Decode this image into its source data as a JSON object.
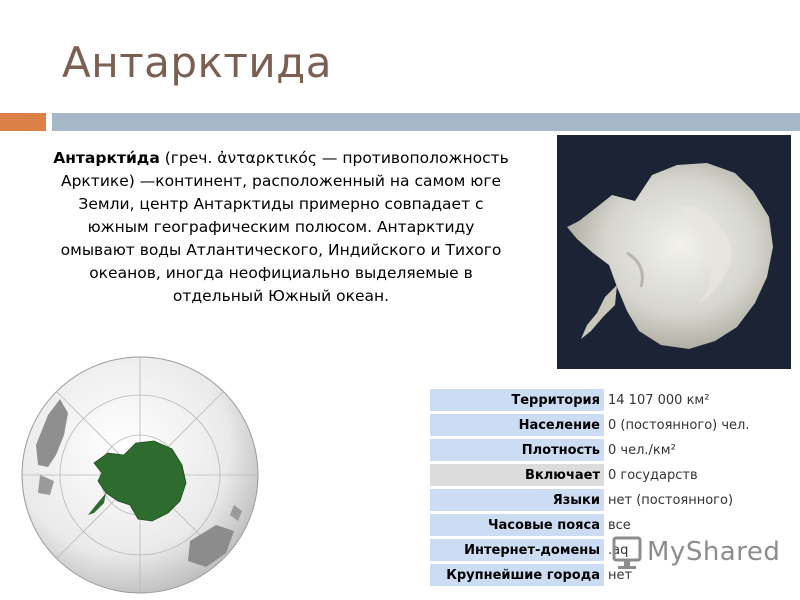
{
  "slide": {
    "title": "Антарктида",
    "paragraph": {
      "term": "Антаркти́да",
      "body": " (греч. ἀνταρκτικός — противоположность Арктике) —континент, расположенный на самом юге Земли, центр Антарктиды примерно совпадает с южным географическим полюсом. Антарктиду омывают воды Атлантического, Индийского и Тихого океанов, иногда неофициально выделяемые в отдельный Южный океан."
    },
    "colors": {
      "title": "#7a5f52",
      "accent_orange": "#dd8047",
      "accent_blue": "#a6b7c7",
      "continent_green": "#2e6b2e"
    }
  },
  "infobox": {
    "rows": [
      {
        "label": "Территория",
        "value": "14 107 000 км²"
      },
      {
        "label": "Население",
        "value": "0 (постоянного) чел."
      },
      {
        "label": "Плотность",
        "value": "0 чел./км²"
      },
      {
        "label": "Включает",
        "value": "0 государств"
      },
      {
        "label": "Языки",
        "value": "нет (постоянного)"
      },
      {
        "label": "Часовые пояса",
        "value": "все"
      },
      {
        "label": "Интернет-домены",
        "value": ".aq"
      },
      {
        "label": "Крупнейшие города",
        "value": "нет"
      }
    ]
  },
  "watermark": {
    "text": "MyShared"
  }
}
